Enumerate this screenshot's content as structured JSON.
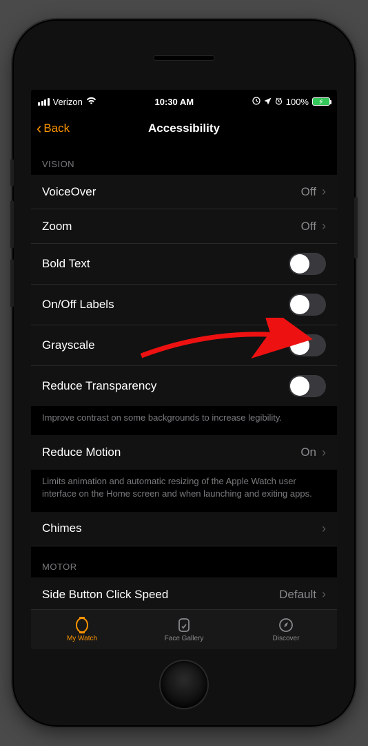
{
  "status": {
    "carrier": "Verizon",
    "time": "10:30 AM",
    "battery_pct": "100%"
  },
  "nav": {
    "back_label": "Back",
    "title": "Accessibility"
  },
  "sections": {
    "vision_header": "VISION",
    "motor_header": "MOTOR"
  },
  "rows": {
    "voiceover": {
      "label": "VoiceOver",
      "value": "Off"
    },
    "zoom": {
      "label": "Zoom",
      "value": "Off"
    },
    "bold_text": {
      "label": "Bold Text"
    },
    "onoff_labels": {
      "label": "On/Off Labels"
    },
    "grayscale": {
      "label": "Grayscale"
    },
    "reduce_transparency": {
      "label": "Reduce Transparency"
    },
    "reduce_transparency_note": "Improve contrast on some backgrounds to increase legibility.",
    "reduce_motion": {
      "label": "Reduce Motion",
      "value": "On"
    },
    "reduce_motion_note": "Limits animation and automatic resizing of the Apple Watch user interface on the Home screen and when launching and exiting apps.",
    "chimes": {
      "label": "Chimes"
    },
    "side_button": {
      "label": "Side Button Click Speed",
      "value": "Default"
    }
  },
  "tabs": {
    "my_watch": "My Watch",
    "face_gallery": "Face Gallery",
    "discover": "Discover"
  }
}
